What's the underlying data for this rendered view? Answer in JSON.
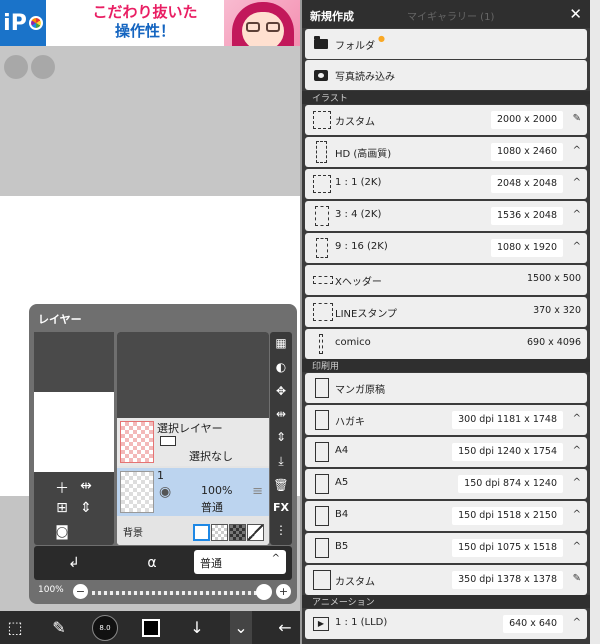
{
  "ad": {
    "logo_text": "iP",
    "line1": "こだわり抜いた",
    "line2": "操作性！"
  },
  "layer_panel": {
    "title": "レイヤー",
    "layers": [
      {
        "name": "選択レイヤー",
        "sub": "選択なし"
      },
      {
        "name": "1",
        "opacity": "100%",
        "blend": "普通"
      }
    ],
    "background_label": "背景",
    "tools": [
      "checker-icon",
      "contrast-icon",
      "move-icon",
      "flip-h-icon",
      "flip-v-icon",
      "merge-down-icon",
      "trash-icon",
      "FX",
      "more-icon"
    ],
    "blend_mode": "普通",
    "opacity_label": "100%"
  },
  "bottom_bar": {
    "brush_size": "8.0"
  },
  "dialog": {
    "title": "新規作成",
    "background_title": "マイギャラリー (1)",
    "top_items": [
      {
        "label": "フォルダ",
        "icon": "folder-icon"
      },
      {
        "label": "写真読み込み",
        "icon": "camera-icon"
      }
    ],
    "sections": [
      {
        "title": "イラスト",
        "items": [
          {
            "label": "カスタム",
            "value": "2000 x 2000",
            "trail": "✎"
          },
          {
            "label": "HD (高画質)",
            "value": "1080 x 2460",
            "trail": "^"
          },
          {
            "label": "1 : 1 (2K)",
            "value": "2048 x 2048",
            "trail": "^"
          },
          {
            "label": "3 : 4 (2K)",
            "value": "1536 x 2048",
            "trail": "^"
          },
          {
            "label": "9 : 16 (2K)",
            "value": "1080 x 1920",
            "trail": "^"
          },
          {
            "label": "Xヘッダー",
            "value": "1500 x  500",
            "trail": ""
          },
          {
            "label": "LINEスタンプ",
            "value": "370 x  320",
            "trail": ""
          },
          {
            "label": "comico",
            "value": "690 x 4096",
            "trail": ""
          }
        ]
      },
      {
        "title": "印刷用",
        "items": [
          {
            "label": "マンガ原稿",
            "value": "",
            "trail": ""
          },
          {
            "label": "ハガキ",
            "value": "300 dpi  1181 x 1748",
            "trail": "^"
          },
          {
            "label": "A4",
            "value": "150 dpi  1240 x 1754",
            "trail": "^"
          },
          {
            "label": "A5",
            "value": "150 dpi   874 x 1240",
            "trail": "^"
          },
          {
            "label": "B4",
            "value": "150 dpi  1518 x 2150",
            "trail": "^"
          },
          {
            "label": "B5",
            "value": "150 dpi  1075 x 1518",
            "trail": "^"
          },
          {
            "label": "カスタム",
            "value": "350 dpi  1378 x 1378",
            "trail": "✎"
          }
        ]
      },
      {
        "title": "アニメーション",
        "items": [
          {
            "label": "1 : 1 (LLD)",
            "value": "640 x  640",
            "trail": "^"
          }
        ]
      }
    ]
  }
}
